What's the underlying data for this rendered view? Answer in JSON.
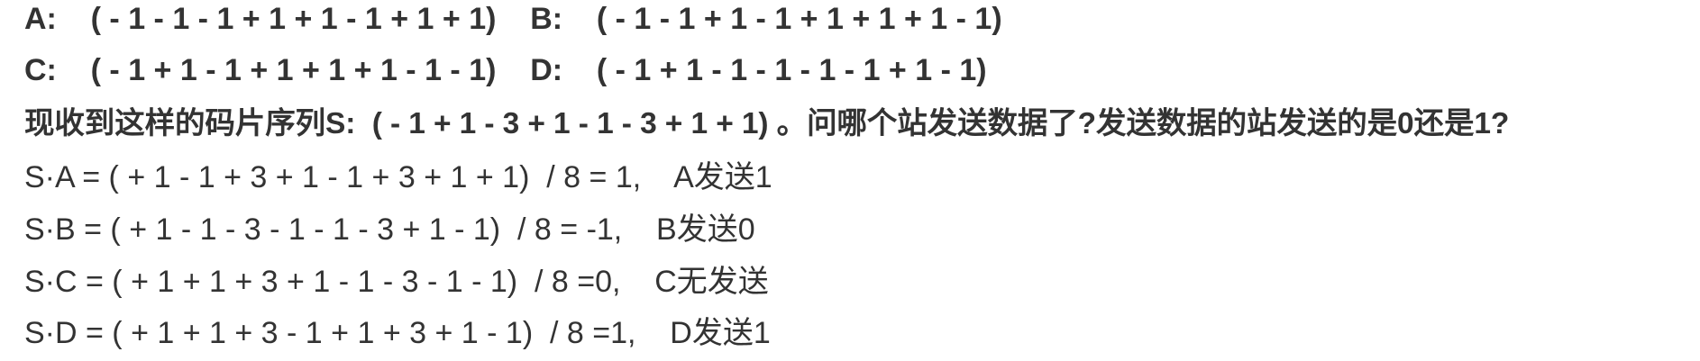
{
  "lines": {
    "ab": "A:    ( - 1 - 1 - 1 + 1 + 1 - 1 + 1 + 1)    B:    ( - 1 - 1 + 1 - 1 + 1 + 1 + 1 - 1)",
    "cd": "C:    ( - 1 + 1 - 1 + 1 + 1 + 1 - 1 - 1)    D:    ( - 1 + 1 - 1 - 1 - 1 - 1 + 1 - 1)",
    "question": "现收到这样的码片序列S:  ( - 1 + 1 - 3 + 1 - 1 - 3 + 1 + 1) 。问哪个站发送数据了?发送数据的站发送的是0还是1?",
    "sa": "S·A = ( + 1 - 1 + 3 + 1 - 1 + 3 + 1 + 1)  / 8 = 1,    A发送1",
    "sb": "S·B = ( + 1 - 1 - 3 - 1 - 1 - 3 + 1 - 1)  / 8 = -1,    B发送0",
    "sc": "S·C = ( + 1 + 1 + 3 + 1 - 1 - 3 - 1 - 1)  / 8 =0,    C无发送",
    "sd": "S·D = ( + 1 + 1 + 3 - 1 + 1 + 3 + 1 - 1)  / 8 =1,    D发送1"
  },
  "colors": {
    "text": "#333333",
    "background": "#ffffff"
  }
}
